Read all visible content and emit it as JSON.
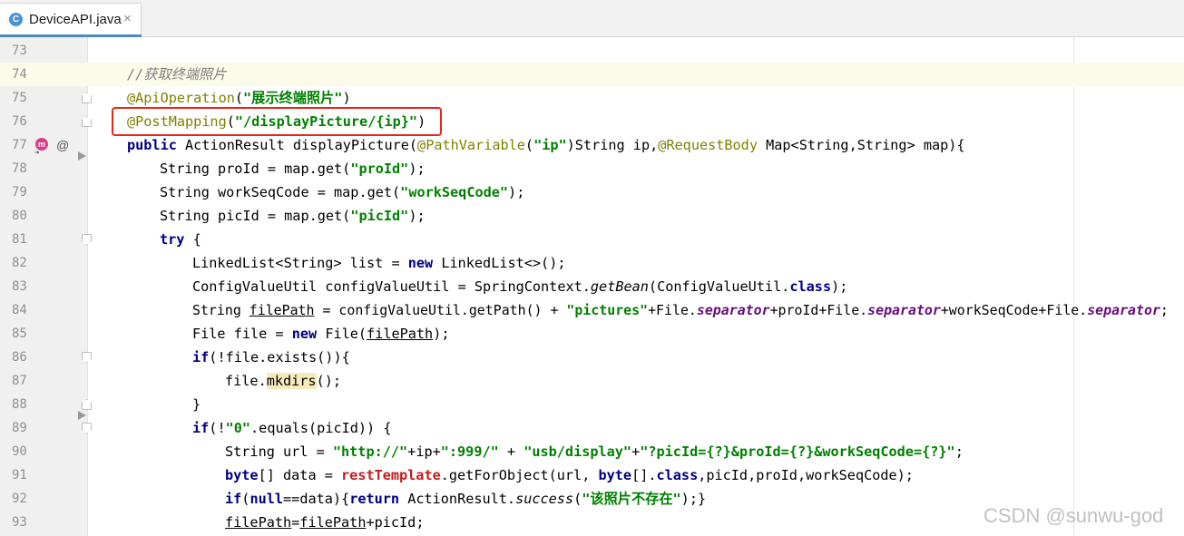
{
  "tab": {
    "icon_letter": "C",
    "title": "DeviceAPI.java",
    "close": "×",
    "icon": "class-icon"
  },
  "gutter": {
    "method_icon_letter": "m",
    "method_icon_arrow": "➜",
    "annotation_icon": "@"
  },
  "lines": {
    "l73": {
      "num": "73"
    },
    "l74": {
      "num": "74",
      "comment": "//获取终端照片"
    },
    "l75": {
      "num": "75",
      "ann": "@ApiOperation",
      "p1": "(",
      "str": "\"展示终端照片\"",
      "p2": ")"
    },
    "l76": {
      "num": "76",
      "ann": "@PostMapping",
      "p1": "(",
      "str": "\"/displayPicture/{ip}\"",
      "p2": ")"
    },
    "l77": {
      "num": "77",
      "kw": "public",
      "t1": " ActionResult displayPicture(",
      "ann1": "@PathVariable",
      "t2": "(",
      "str": "\"ip\"",
      "t3": ")String ip,",
      "ann2": "@RequestBody",
      "t4": " Map<String,String> map){"
    },
    "l78": {
      "num": "78",
      "t1": "String proId = map.get(",
      "str": "\"proId\"",
      "t2": ");"
    },
    "l79": {
      "num": "79",
      "t1": "String workSeqCode = map.get(",
      "str": "\"workSeqCode\"",
      "t2": ");"
    },
    "l80": {
      "num": "80",
      "t1": "String picId = map.get(",
      "str": "\"picId\"",
      "t2": ");"
    },
    "l81": {
      "num": "81",
      "kw": "try",
      "t1": " {"
    },
    "l82": {
      "num": "82",
      "t1": "LinkedList<String> list = ",
      "kw": "new",
      "t2": " LinkedList<>();"
    },
    "l83": {
      "num": "83",
      "t1": "ConfigValueUtil configValueUtil = SpringContext.",
      "m": "getBean",
      "t2": "(ConfigValueUtil.",
      "kw": "class",
      "t3": ");"
    },
    "l84": {
      "num": "84",
      "t1": "String ",
      "v": "filePath",
      "t2": " = configValueUtil.getPath() + ",
      "str": "\"pictures\"",
      "t3": "+File.",
      "f1": "separator",
      "t4": "+proId+File.",
      "f2": "separator",
      "t5": "+workSeqCode+File.",
      "f3": "separator",
      "t6": ";"
    },
    "l85": {
      "num": "85",
      "t1": "File file = ",
      "kw": "new",
      "t2": " File(",
      "v": "filePath",
      "t3": ");"
    },
    "l86": {
      "num": "86",
      "kw": "if",
      "t1": "(!file.exists()){"
    },
    "l87": {
      "num": "87",
      "t1": "file.",
      "w": "mkdirs",
      "t2": "();"
    },
    "l88": {
      "num": "88",
      "t1": "}"
    },
    "l89": {
      "num": "89",
      "kw": "if",
      "t1": "(!",
      "str": "\"0\"",
      "t2": ".equals(picId)) {"
    },
    "l90": {
      "num": "90",
      "t1": "String url = ",
      "s1": "\"http://\"",
      "t2": "+ip+",
      "s2": "\":999/\"",
      "t3": " + ",
      "s3": "\"usb/display\"",
      "t4": "+",
      "s4": "\"?picId={?}&proId={?}&workSeqCode={?}\"",
      "t5": ";"
    },
    "l91": {
      "num": "91",
      "kw1": "byte",
      "t1": "[] data = ",
      "r": "restTemplate",
      "t2": ".getForObject(url, ",
      "kw2": "byte",
      "t3": "[].",
      "kw3": "class",
      "t4": ",picId,proId,workSeqCode);"
    },
    "l92": {
      "num": "92",
      "kw1": "if",
      "t1": "(",
      "kw2": "null",
      "t2": "==data){",
      "kw3": "return",
      "t3": " ActionResult.",
      "m": "success",
      "t4": "(",
      "str": "\"该照片不存在\"",
      "t5": ");}"
    },
    "l93": {
      "num": "93",
      "v1": "filePath",
      "t1": "=",
      "v2": "filePath",
      "t2": "+picId;"
    }
  },
  "watermark": "CSDN @sunwu-god",
  "colors": {
    "keyword": "#000080",
    "string": "#008000",
    "annotation": "#808000",
    "comment": "#808080",
    "static_field": "#660e7a",
    "highlight_box": "#e8251b",
    "current_line": "#fcfae8"
  }
}
